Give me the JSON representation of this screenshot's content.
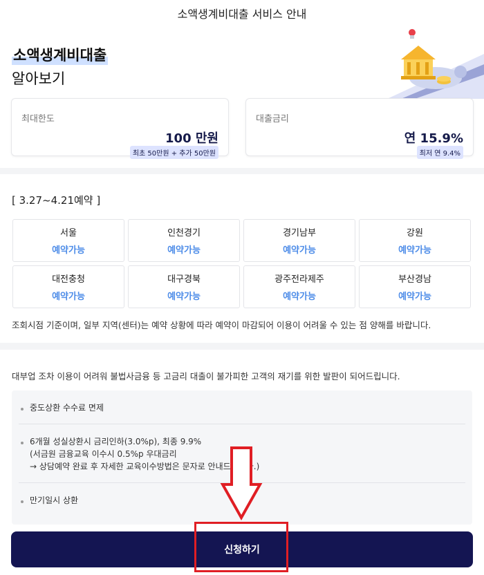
{
  "header": {
    "title": "소액생계비대출 서비스 안내"
  },
  "hero": {
    "title_line1": "소액생계비대출",
    "title_line2": "알아보기",
    "illustration_icon": "bank-building-icon"
  },
  "stats": [
    {
      "label": "최대한도",
      "value": "100 만원",
      "note": "최초 50만원 + 추가 50만원"
    },
    {
      "label": "대출금리",
      "value": "연 15.9%",
      "note": "최저 연 9.4%"
    }
  ],
  "reservation": {
    "period": "[ 3.27~4.21예약 ]",
    "regions": [
      {
        "name": "서울",
        "status": "예약가능"
      },
      {
        "name": "인천경기",
        "status": "예약가능"
      },
      {
        "name": "경기남부",
        "status": "예약가능"
      },
      {
        "name": "강원",
        "status": "예약가능"
      },
      {
        "name": "대전충청",
        "status": "예약가능"
      },
      {
        "name": "대구경북",
        "status": "예약가능"
      },
      {
        "name": "광주전라제주",
        "status": "예약가능"
      },
      {
        "name": "부산경남",
        "status": "예약가능"
      }
    ],
    "notice": "조회시점 기준이며, 일부 지역(센터)는 예약 상황에 따라 예약이 마감되어 이용이 어려울 수 있는 점 양해를 바랍니다."
  },
  "description": "대부업 조차 이용이 어려워 불법사금융 등 고금리 대출이 불가피한 고객의 재기를 위한 발판이 되어드립니다.",
  "benefits": [
    {
      "lines": [
        "중도상환 수수료 면제"
      ]
    },
    {
      "lines": [
        "6개월 성실상환시 금리인하(3.0%p), 최종 9.9%",
        "(서금원 금융교육 이수시 0.5%p 우대금리",
        "→ 상담예약 완료 후 자세한 교육이수방법은 문자로 안내드립니다.)"
      ]
    },
    {
      "lines": [
        "만기일시 상환"
      ]
    }
  ],
  "apply_button": {
    "label": "신청하기"
  },
  "colors": {
    "primary": "#141552",
    "accent": "#4d8ce8",
    "highlight": "#e01e24"
  }
}
